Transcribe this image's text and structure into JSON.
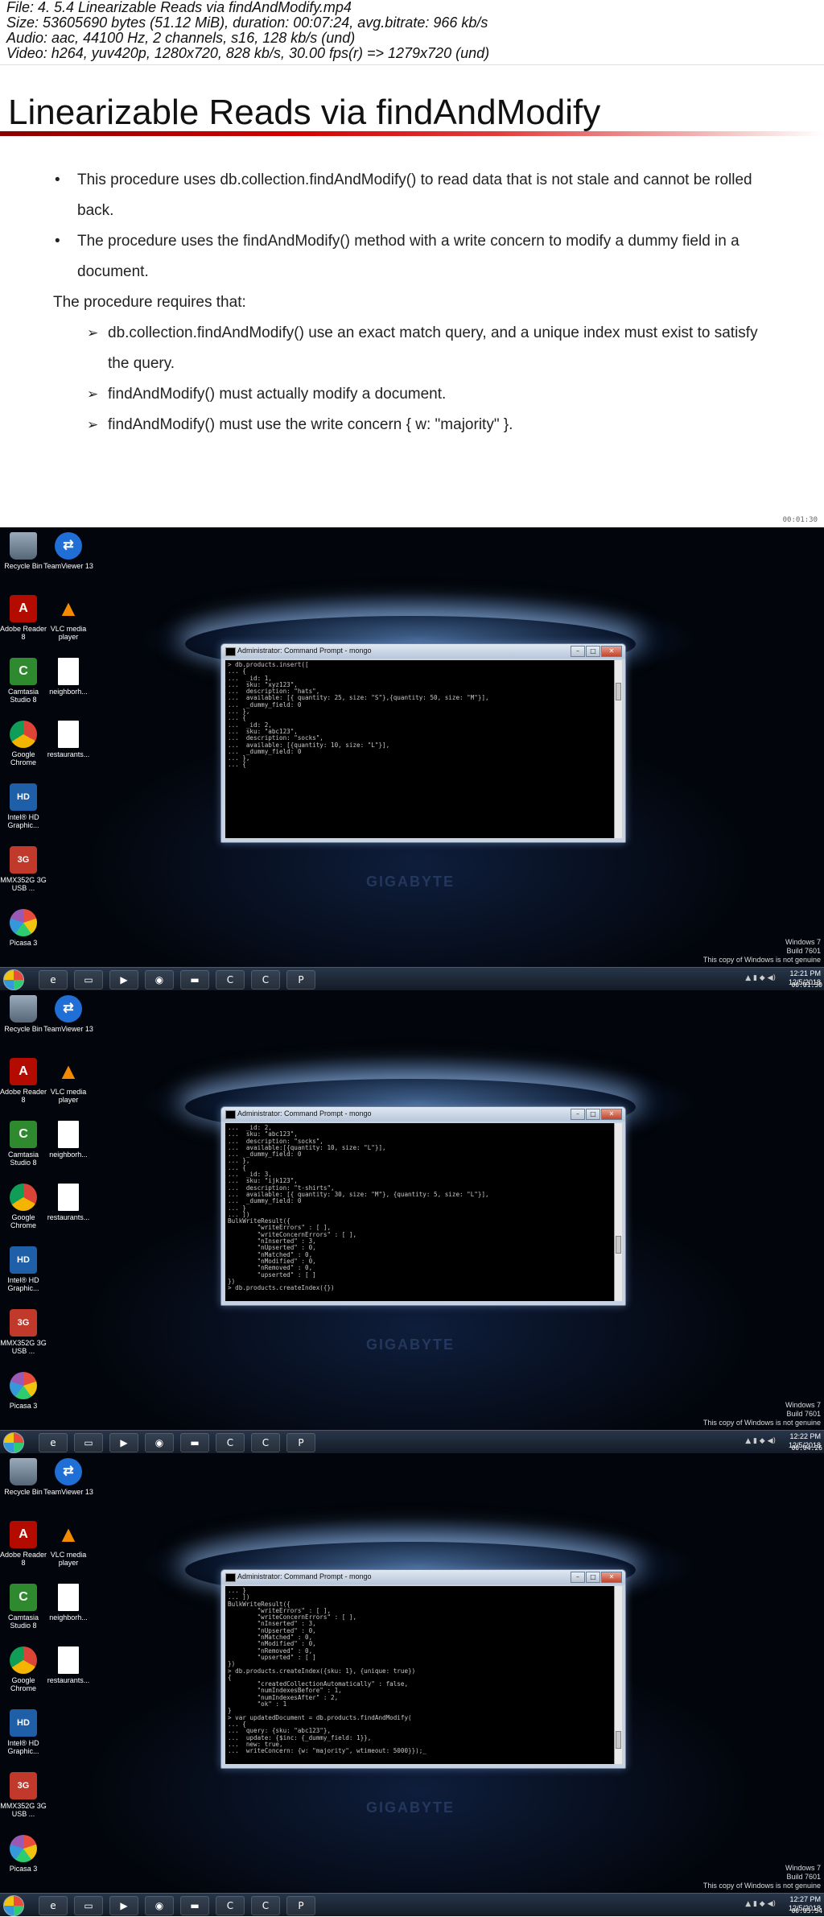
{
  "header": {
    "line1": "File: 4. 5.4 Linearizable Reads via findAndModify.mp4",
    "line2": "Size: 53605690 bytes (51.12 MiB), duration: 00:07:24, avg.bitrate: 966 kb/s",
    "line3": "Audio: aac, 44100 Hz, 2 channels, s16, 128 kb/s (und)",
    "line4": "Video: h264, yuv420p, 1280x720, 828 kb/s, 30.00 fps(r) => 1279x720 (und)"
  },
  "slide": {
    "title": "Linearizable Reads via findAndModify",
    "bullets": [
      "This procedure uses db.collection.findAndModify() to read data that is not stale and cannot be rolled back.",
      "The procedure uses the findAndModify() method with a write concern to modify a dummy field in a document."
    ],
    "requires_heading": "The procedure requires that:",
    "sub_bullets": [
      "db.collection.findAndModify() use an exact match query, and a unique index must exist to satisfy the query.",
      "findAndModify() must actually modify a document.",
      "findAndModify() must use the write concern { w: \"majority\" }."
    ],
    "timestamp": "00:01:30"
  },
  "desktop": {
    "icons": [
      {
        "label": "Recycle Bin",
        "icon": "recycle-bin-icon"
      },
      {
        "label": "TeamViewer 13",
        "icon": "teamviewer-icon"
      },
      {
        "label": "Adobe Reader 8",
        "icon": "adobe-reader-icon"
      },
      {
        "label": "VLC media player",
        "icon": "vlc-icon"
      },
      {
        "label": "Camtasia Studio 8",
        "icon": "camtasia-icon"
      },
      {
        "label": "neighborh...",
        "icon": "document-icon"
      },
      {
        "label": "Google Chrome",
        "icon": "chrome-icon"
      },
      {
        "label": "restaurants...",
        "icon": "document-icon"
      },
      {
        "label": "Intel® HD Graphic...",
        "icon": "intel-icon"
      },
      {
        "label": "MMX352G 3G USB ...",
        "icon": "mmx-icon"
      },
      {
        "label": "Picasa 3",
        "icon": "picasa-icon"
      }
    ],
    "window_title": "Administrator: Command Prompt - mongo",
    "genuine_line1": "Windows 7",
    "genuine_line2": "Build 7601",
    "genuine_line3": "This copy of Windows is not genuine",
    "watermark": "GIGABYTE"
  },
  "frames": [
    {
      "terminal": "> db.products.insert([\n... {\n...  _id: 1,\n...  sku: \"xyz123\",\n...  description: \"hats\",\n...  available: [{ quantity: 25, size: \"S\"},{quantity: 50, size: \"M\"}],\n...  _dummy_field: 0\n... },\n... {\n...  _id: 2,\n...  sku: \"abc123\",\n...  description: \"socks\",\n...  available: [{quantity: 10, size: \"L\"}],\n...  _dummy_field: 0\n... },\n... {",
      "clock_time": "12:21 PM",
      "clock_date": "12/5/2018",
      "timestamp": "00:01:30"
    },
    {
      "terminal": "...  _id: 2,\n...  sku: \"abc123\",\n...  description: \"socks\",\n...  available:[{quantity: 10, size: \"L\"}],\n...  _dummy_field: 0\n... },\n... {\n...  _id: 3,\n...  sku: \"ijk123\",\n...  description: \"t-shirts\",\n...  available: [{ quantity: 30, size: \"M\"}, {quantity: 5, size: \"L\"}],\n...  _dummy_field: 0\n... }\n... ])\nBulkWriteResult({\n        \"writeErrors\" : [ ],\n        \"writeConcernErrors\" : [ ],\n        \"nInserted\" : 3,\n        \"nUpserted\" : 0,\n        \"nMatched\" : 0,\n        \"nModified\" : 0,\n        \"nRemoved\" : 0,\n        \"upserted\" : [ ]\n})\n> db.products.createIndex({})",
      "clock_time": "12:22 PM",
      "clock_date": "12/5/2018",
      "timestamp": "00:04:26"
    },
    {
      "terminal": "... }\n... ])\nBulkWriteResult({\n        \"writeErrors\" : [ ],\n        \"writeConcernErrors\" : [ ],\n        \"nInserted\" : 3,\n        \"nUpserted\" : 0,\n        \"nMatched\" : 0,\n        \"nModified\" : 0,\n        \"nRemoved\" : 0,\n        \"upserted\" : [ ]\n})\n> db.products.createIndex({sku: 1}, {unique: true})\n{\n        \"createdCollectionAutomatically\" : false,\n        \"numIndexesBefore\" : 1,\n        \"numIndexesAfter\" : 2,\n        \"ok\" : 1\n}\n> var updatedDocument = db.products.findAndModify(\n... {\n...  query: {sku: \"abc123\"},\n...  update: {$inc: {_dummy_field: 1}},\n...  new: true,\n...  writeConcern: {w: \"majority\", wtimeout: 5000}});_",
      "clock_time": "12:27 PM",
      "clock_date": "12/5/2018",
      "timestamp": "00:05:54"
    }
  ]
}
